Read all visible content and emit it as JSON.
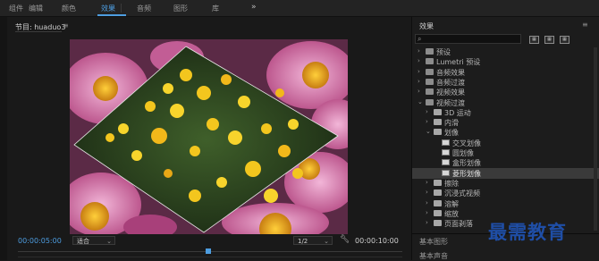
{
  "top_menu": {
    "tabs": [
      {
        "label": "组件"
      },
      {
        "label": "编辑"
      },
      {
        "label": "颜色"
      },
      {
        "label": "效果"
      },
      {
        "label": "音频"
      },
      {
        "label": "图形"
      },
      {
        "label": "库"
      }
    ],
    "active_tab": "效果",
    "more_label": "»"
  },
  "program_monitor": {
    "title": "节目: huaduo3",
    "menu_icon": "≡",
    "timecode_current": "00:00:05:00",
    "fit_value": "适合",
    "resolution_value": "1/2",
    "timecode_duration": "00:00:10:00",
    "settings_icon": "wrench-icon"
  },
  "effects_panel": {
    "title": "效果",
    "menu_icon": "≡",
    "search_placeholder": "",
    "filter_icons": [
      "accelerated-effects-icon",
      "32bit-effects-icon",
      "yuv-effects-icon"
    ],
    "tree": [
      {
        "label": "预设",
        "depth": 0,
        "expanded": false,
        "kind": "folder"
      },
      {
        "label": "Lumetri 预设",
        "depth": 0,
        "expanded": false,
        "kind": "folder"
      },
      {
        "label": "音频效果",
        "depth": 0,
        "expanded": false,
        "kind": "folder"
      },
      {
        "label": "音频过渡",
        "depth": 0,
        "expanded": false,
        "kind": "folder"
      },
      {
        "label": "视频效果",
        "depth": 0,
        "expanded": false,
        "kind": "folder"
      },
      {
        "label": "视频过渡",
        "depth": 0,
        "expanded": true,
        "kind": "folder"
      },
      {
        "label": "3D 运动",
        "depth": 1,
        "expanded": false,
        "kind": "bin"
      },
      {
        "label": "内滑",
        "depth": 1,
        "expanded": false,
        "kind": "bin"
      },
      {
        "label": "划像",
        "depth": 1,
        "expanded": true,
        "kind": "bin"
      },
      {
        "label": "交叉划像",
        "depth": 2,
        "kind": "effect"
      },
      {
        "label": "圆划像",
        "depth": 2,
        "kind": "effect"
      },
      {
        "label": "盒形划像",
        "depth": 2,
        "kind": "effect"
      },
      {
        "label": "菱形划像",
        "depth": 2,
        "kind": "effect",
        "selected": true
      },
      {
        "label": "擦除",
        "depth": 1,
        "expanded": false,
        "kind": "bin"
      },
      {
        "label": "沉浸式视频",
        "depth": 1,
        "expanded": false,
        "kind": "bin"
      },
      {
        "label": "溶解",
        "depth": 1,
        "expanded": false,
        "kind": "bin"
      },
      {
        "label": "缩放",
        "depth": 1,
        "expanded": false,
        "kind": "bin"
      },
      {
        "label": "页面剥落",
        "depth": 1,
        "expanded": false,
        "kind": "bin"
      }
    ],
    "bottom_tabs": [
      {
        "label": "基本图形"
      },
      {
        "label": "基本声音"
      }
    ]
  },
  "watermark": "最需教育",
  "colors": {
    "accent": "#4d9de0",
    "panel_bg": "#1c1c1c",
    "selection_bg": "#3a3a3a",
    "watermark": "#1f4ea6"
  }
}
